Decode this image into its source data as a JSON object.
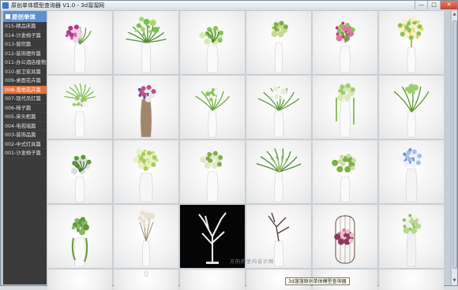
{
  "window": {
    "title": "原创单体模型查询器 V1.0 - 3d溜溜网",
    "min_label": "—",
    "max_label": "□",
    "close_label": "✕"
  },
  "sidebar": {
    "header": "原创单体",
    "items": [
      {
        "label": "015-精品床篇",
        "active": false
      },
      {
        "label": "014-沙发椅子篇",
        "active": false
      },
      {
        "label": "013-窗帘篇",
        "active": false
      },
      {
        "label": "012-装饰摆件篇",
        "active": false
      },
      {
        "label": "011-办公酒店植物篇",
        "active": false
      },
      {
        "label": "010-厨卫家具篇",
        "active": false
      },
      {
        "label": "009-桌面花卉篇",
        "active": false
      },
      {
        "label": "008-落地花卉篇",
        "active": true
      },
      {
        "label": "007-现代吊灯篇",
        "active": false
      },
      {
        "label": "006-椅子篇",
        "active": false
      },
      {
        "label": "005-床头柜篇",
        "active": false
      },
      {
        "label": "004-电视墙篇",
        "active": false
      },
      {
        "label": "003-装饰品篇",
        "active": false
      },
      {
        "label": "002-中式灯具篇",
        "active": false
      },
      {
        "label": "001-沙发椅子篇",
        "active": false
      }
    ]
  },
  "tiles": [
    {
      "type": "orchid-vase"
    },
    {
      "type": "green-spray"
    },
    {
      "type": "white-bouquet"
    },
    {
      "type": "cream-bouquet"
    },
    {
      "type": "pink-bouquet"
    },
    {
      "type": "round-bush"
    },
    {
      "type": "palm-bouquet"
    },
    {
      "type": "purple-wicker"
    },
    {
      "type": "green-stems"
    },
    {
      "type": "white-stems"
    },
    {
      "type": "hanging-amaranth"
    },
    {
      "type": "green-spike"
    },
    {
      "type": "white-lily"
    },
    {
      "type": "lime-cluster"
    },
    {
      "type": "round-white"
    },
    {
      "type": "grass-tall"
    },
    {
      "type": "white-lace"
    },
    {
      "type": "blue-hydrangea"
    },
    {
      "type": "succulent-vine"
    },
    {
      "type": "dry-twigs"
    },
    {
      "type": "white-tree"
    },
    {
      "type": "dark-branch"
    },
    {
      "type": "pink-cage"
    },
    {
      "type": "green-hang"
    },
    {
      "type": "partial"
    },
    {
      "type": "partial-cage"
    },
    {
      "type": "partial"
    },
    {
      "type": "partial"
    },
    {
      "type": "partial"
    },
    {
      "type": "partial"
    }
  ],
  "watermark": "方的的室内设计网",
  "tooltip": "3d溜溜原创单体模型查询器"
}
